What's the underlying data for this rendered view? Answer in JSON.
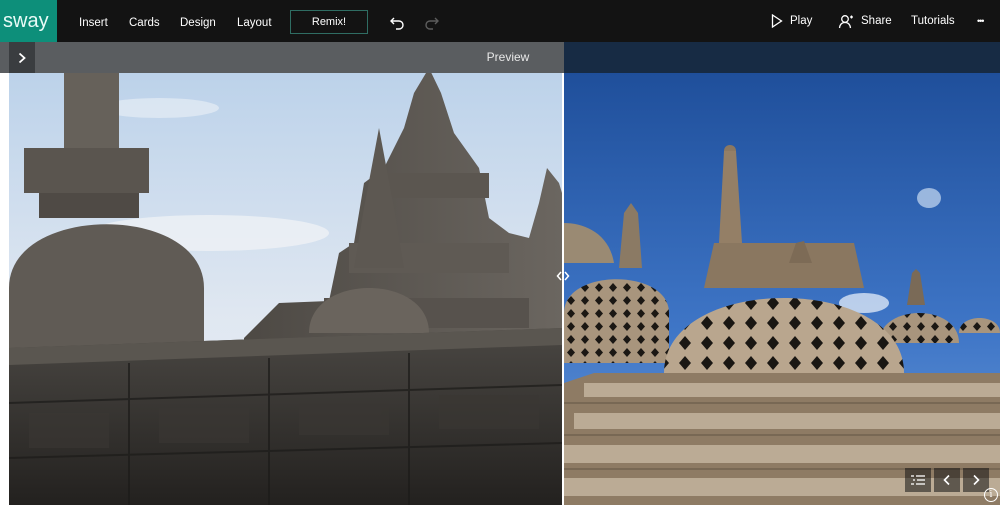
{
  "app": {
    "logo_text": "sway"
  },
  "menu": {
    "insert": "Insert",
    "cards": "Cards",
    "design": "Design",
    "layout": "Layout",
    "remix": "Remix!"
  },
  "toolbar_right": {
    "play": "Play",
    "share": "Share",
    "tutorials": "Tutorials",
    "more": "•••"
  },
  "preview": {
    "title": "Preview"
  },
  "icons": {
    "undo": "undo-icon",
    "redo": "redo-icon",
    "play": "play-icon",
    "share": "share-person-icon",
    "collapse": "chevron-right-icon",
    "divider": "compare-handle-icon",
    "navigation": "navigation-list-icon",
    "previous": "chevron-left-icon",
    "next": "chevron-right-icon",
    "info": "info-icon"
  },
  "info_label": "i",
  "colors": {
    "logo_bg": "#0d8f7a",
    "topbar_bg": "#131313",
    "remix_border": "#2f6d63",
    "preview_left_bg": "#5a5d60",
    "preview_right_bg": "#172b44"
  }
}
